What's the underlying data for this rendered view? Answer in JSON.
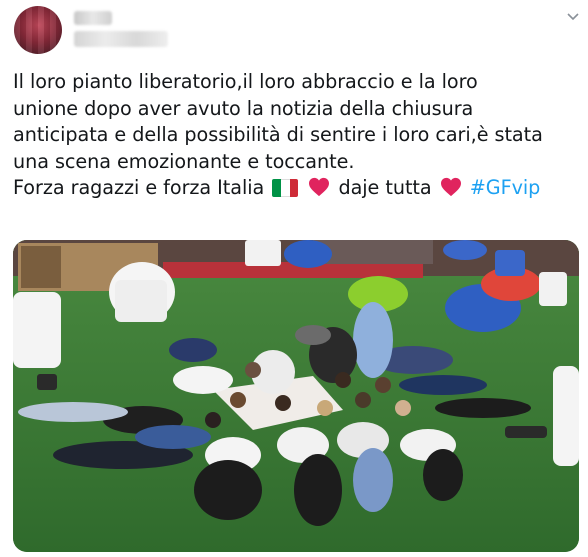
{
  "tweet": {
    "author_avatar": "avatar-blurred",
    "menu_icon": "chevron-down-icon",
    "text_lines": [
      "Il loro pianto liberatorio,il loro abbraccio e la loro",
      "unione dopo aver avuto la notizia della chiusura",
      "anticipata e della possibilità di sentire i loro cari,è stata",
      "una scena emozionante e toccante."
    ],
    "line5_part1": "Forza ragazzi e forza Italia",
    "line5_part2": "daje tutta",
    "hashtag": "#GFvip",
    "photo_alt": "group of people lying on artificial grass in a circle",
    "colors": {
      "hashtag": "#1da1f2",
      "heart": "#e0245e",
      "grass": "#3f7a3a"
    }
  }
}
